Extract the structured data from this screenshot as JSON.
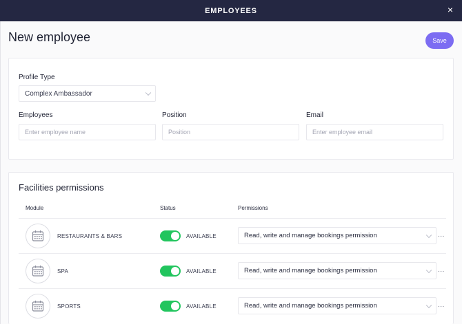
{
  "header": {
    "title": "EMPLOYEES",
    "close_glyph": "×"
  },
  "page": {
    "title": "New employee",
    "save_label": "Save"
  },
  "profile": {
    "type_label": "Profile Type",
    "type_value": "Complex Ambassador"
  },
  "fields": {
    "employees_label": "Employees",
    "employees_placeholder": "Enter employee name",
    "position_label": "Position",
    "position_placeholder": "Position",
    "email_label": "Email",
    "email_placeholder": "Enter employee email"
  },
  "facilities": {
    "title": "Facilities permissions",
    "columns": {
      "module": "Module",
      "status": "Status",
      "permissions": "Permissions"
    },
    "rows": [
      {
        "module": "RESTAURANTS & BARS",
        "status": "AVAILABLE",
        "permission": "Read, write and manage bookings permission",
        "icon": "calendar-icon",
        "enabled": true
      },
      {
        "module": "SPA",
        "status": "AVAILABLE",
        "permission": "Read, write and manage bookings permission",
        "icon": "calendar-icon",
        "enabled": true
      },
      {
        "module": "SPORTS",
        "status": "AVAILABLE",
        "permission": "Read, write and manage bookings permission",
        "icon": "calendar-icon",
        "enabled": true
      }
    ],
    "more_glyph": "..."
  },
  "colors": {
    "header_bg": "#242742",
    "accent": "#7c6cf2",
    "toggle_on": "#22c55e"
  }
}
